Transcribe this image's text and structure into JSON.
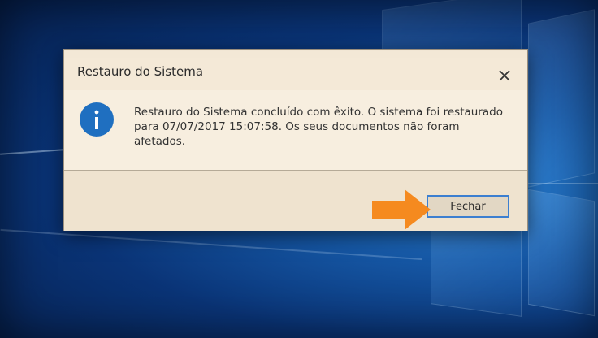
{
  "dialog": {
    "title": "Restauro do Sistema",
    "message": "Restauro do Sistema concluído com êxito. O sistema foi restaurado para 07/07/2017 15:07:58. Os seus documentos não foram afetados.",
    "close_button_label": "Fechar",
    "info_icon_glyph": "i",
    "close_icon": "close-icon",
    "info_icon": "info-icon"
  },
  "annotation": {
    "arrow_icon": "arrow-right-icon",
    "arrow_color": "#f58a1f"
  },
  "colors": {
    "dialog_background": "#f4e9d7",
    "button_border": "#3c7fd0",
    "info_icon": "#1f6fc0",
    "desktop_background": "#0a3477"
  }
}
